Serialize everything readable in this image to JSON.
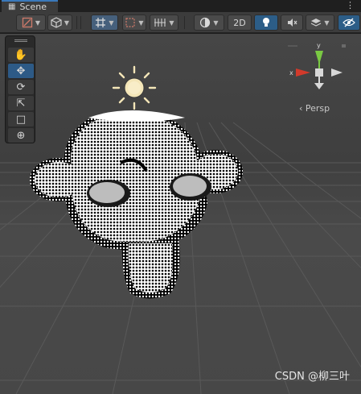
{
  "tab": {
    "label": "Scene",
    "icon": "grid-icon",
    "menu_icon": "kebab-icon"
  },
  "toolbar": {
    "twod_label": "2D",
    "buttons": [
      "draw-mode-icon",
      "shading-cube-icon",
      "grid-snap-icon",
      "snap-increment-icon",
      "grid-toggle-icon",
      "render-sphere-icon",
      "lighting-bulb-icon",
      "audio-mute-icon",
      "effects-stack-icon",
      "scene-visibility-icon"
    ]
  },
  "tools": [
    "hand-tool-icon",
    "move-tool-icon",
    "rotate-tool-icon",
    "scale-tool-icon",
    "rect-tool-icon",
    "transform-tool-icon"
  ],
  "selected_tool": "move-tool-icon",
  "gizmo": {
    "y_label": "y",
    "x_label": "x",
    "persp_label": "‹ Persp"
  },
  "watermark": "CSDN @柳三叶",
  "colors": {
    "accent_blue": "#2d5a86",
    "x_axis": "#d23a2b",
    "y_axis": "#7ac943",
    "sun": "#f4e6b8"
  }
}
